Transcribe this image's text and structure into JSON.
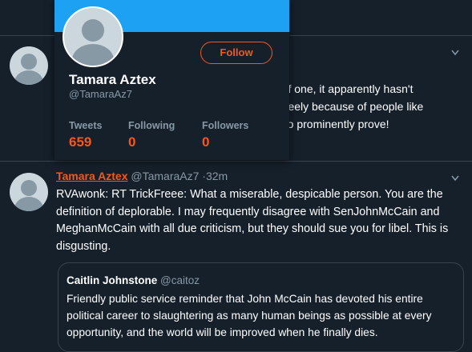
{
  "tweet1": {
    "partial_lines": [
      "d of one, it apparently hasn't",
      "s freely because of people like",
      "u so prominently prove!"
    ]
  },
  "tweet2": {
    "name": "Tamara Aztex",
    "handle": "@TamaraAz7",
    "separator": "·",
    "time": "32m",
    "lines": [
      "RVAwonk: RT TrickFreee: What a miserable, despicable person. You are the",
      "definition of deplorable.  I may frequently disagree with SenJohnMcCain and",
      "MeghanMcCain with all due criticism, but they should sue you for libel. This is",
      "disgusting."
    ]
  },
  "quote": {
    "name": "Caitlin Johnstone",
    "handle": "@caitoz",
    "lines": [
      "Friendly public service reminder that John McCain has devoted his entire",
      "political career to slaughtering as many human beings as possible at every",
      "opportunity, and the world will be improved when he finally dies."
    ]
  },
  "hover_card": {
    "name": "Tamara Aztex",
    "handle": "@TamaraAz7",
    "follow_label": "Follow",
    "stats": [
      {
        "label": "Tweets",
        "value": "659"
      },
      {
        "label": "Following",
        "value": "0"
      },
      {
        "label": "Followers",
        "value": "0"
      }
    ]
  },
  "icons": {
    "caret": "chevron-down-icon",
    "avatar": "default-avatar-icon"
  },
  "colors": {
    "background": "#15202b",
    "accent": "#f4581b",
    "banner": "#1da1f2",
    "muted": "#8899a6",
    "divider": "#38444d"
  }
}
